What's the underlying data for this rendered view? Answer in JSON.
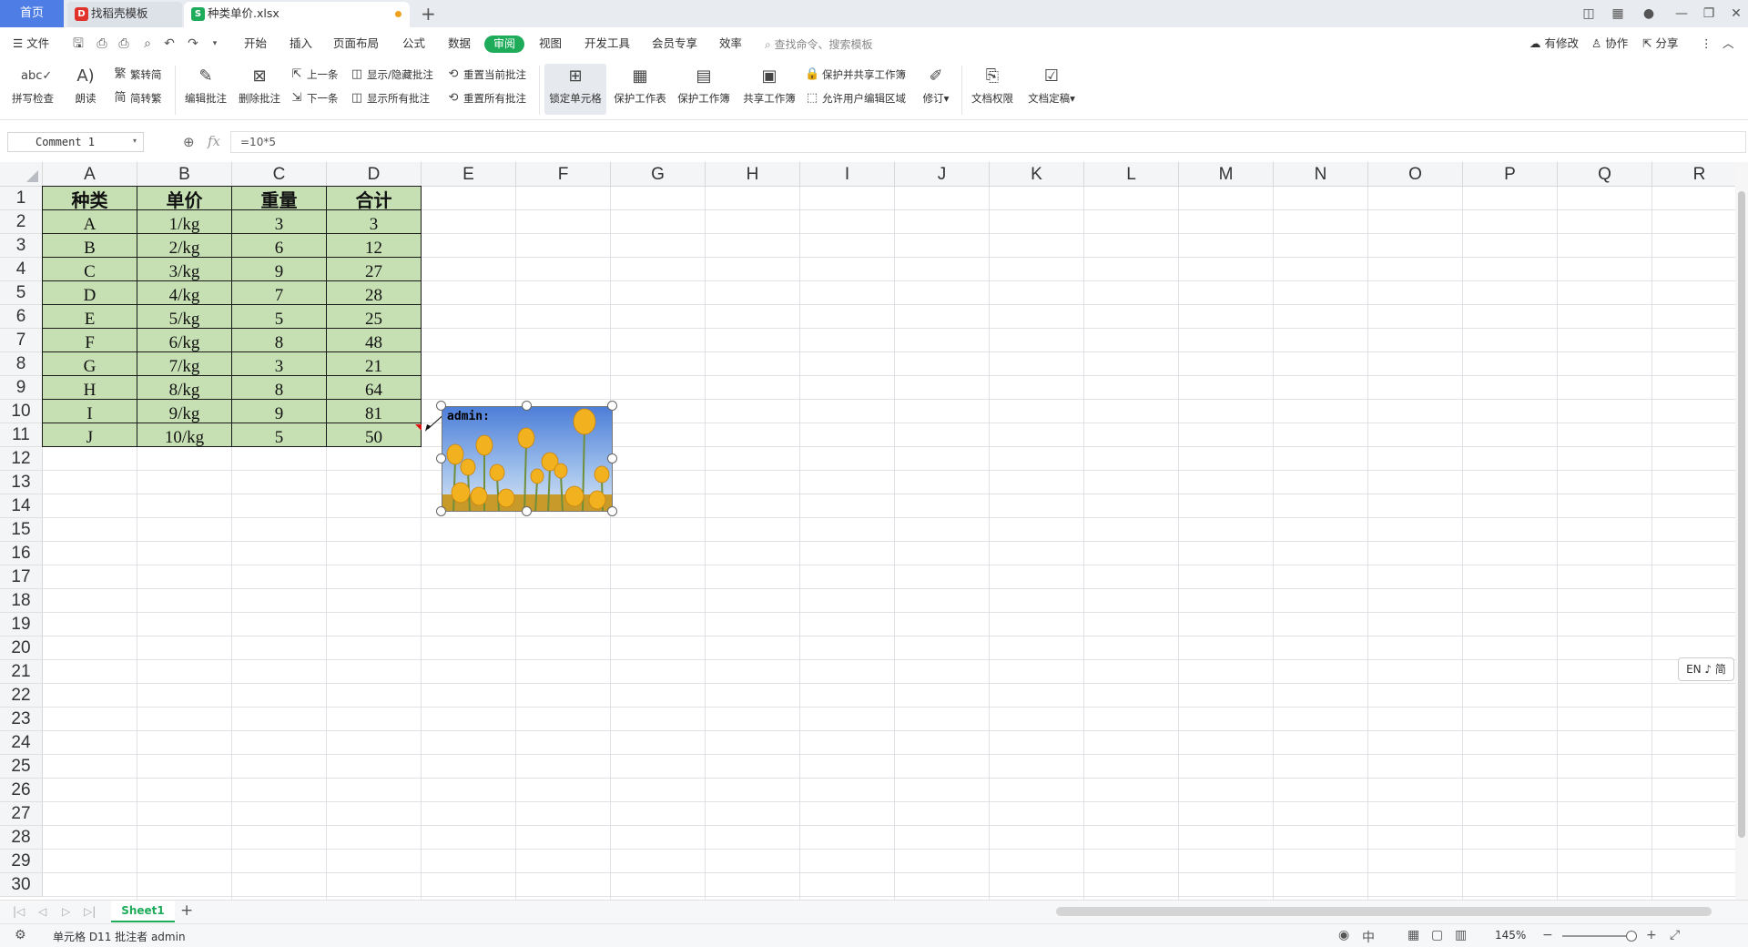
{
  "titlebar": {
    "home_tab": "首页",
    "template_tab": "找稻壳模板",
    "file_tab": "种类单价.xlsx"
  },
  "menubar": {
    "file_label": "文件",
    "items": [
      "开始",
      "插入",
      "页面布局",
      "公式",
      "数据",
      "审阅",
      "视图",
      "开发工具",
      "会员专享",
      "效率"
    ],
    "active_index": 5,
    "search_placeholder": "查找命令、搜索模板",
    "right_actions": [
      "有修改",
      "协作",
      "分享"
    ]
  },
  "ribbon": {
    "spell_check": "拼写检查",
    "read_aloud": "朗读",
    "trad_to_simp": "繁转简",
    "simp_to_trad": "简转繁",
    "edit_comment": "编辑批注",
    "delete_comment": "删除批注",
    "prev_comment": "上一条",
    "next_comment": "下一条",
    "show_hide_comment": "显示/隐藏批注",
    "show_all_comments": "显示所有批注",
    "reset_current_comment": "重置当前批注",
    "reset_all_comments": "重置所有批注",
    "lock_cell": "锁定单元格",
    "protect_sheet": "保护工作表",
    "protect_workbook": "保护工作簿",
    "share_workbook": "共享工作簿",
    "protect_share_workbook": "保护并共享工作簿",
    "allow_edit_ranges": "允许用户编辑区域",
    "track_changes": "修订",
    "doc_permission": "文档权限",
    "doc_finalize": "文档定稿"
  },
  "formula": {
    "name_box": "Comment 1",
    "fx": "fx",
    "value": "=10*5"
  },
  "columns": [
    "A",
    "B",
    "C",
    "D",
    "E",
    "F",
    "G",
    "H",
    "I",
    "J",
    "K",
    "L",
    "M",
    "N",
    "O",
    "P",
    "Q",
    "R"
  ],
  "rows": [
    "1",
    "2",
    "3",
    "4",
    "5",
    "6",
    "7",
    "8",
    "9",
    "10",
    "11",
    "12",
    "13",
    "14",
    "15",
    "16",
    "17",
    "18",
    "19",
    "20",
    "21",
    "22",
    "23",
    "24",
    "25",
    "26",
    "27",
    "28",
    "29",
    "30"
  ],
  "table": {
    "headers": [
      "种类",
      "单价",
      "重量",
      "合计"
    ],
    "rows": [
      [
        "A",
        "1/kg",
        "3",
        "3"
      ],
      [
        "B",
        "2/kg",
        "6",
        "12"
      ],
      [
        "C",
        "3/kg",
        "9",
        "27"
      ],
      [
        "D",
        "4/kg",
        "7",
        "28"
      ],
      [
        "E",
        "5/kg",
        "5",
        "25"
      ],
      [
        "F",
        "6/kg",
        "8",
        "48"
      ],
      [
        "G",
        "7/kg",
        "3",
        "21"
      ],
      [
        "H",
        "8/kg",
        "8",
        "64"
      ],
      [
        "I",
        "9/kg",
        "9",
        "81"
      ],
      [
        "J",
        "10/kg",
        "5",
        "50"
      ]
    ],
    "fill_color": "#c6e0b4"
  },
  "comment": {
    "author_text": "admin:"
  },
  "ime_indicator": "EN ♪ 简",
  "sheets": [
    "Sheet1"
  ],
  "status": {
    "text": "单元格 D11 批注者 admin",
    "zoom": "145%"
  },
  "colors": {
    "accent": "#1eac5a",
    "home_tab": "#4f7de6",
    "comment_marker": "#dd1111"
  }
}
